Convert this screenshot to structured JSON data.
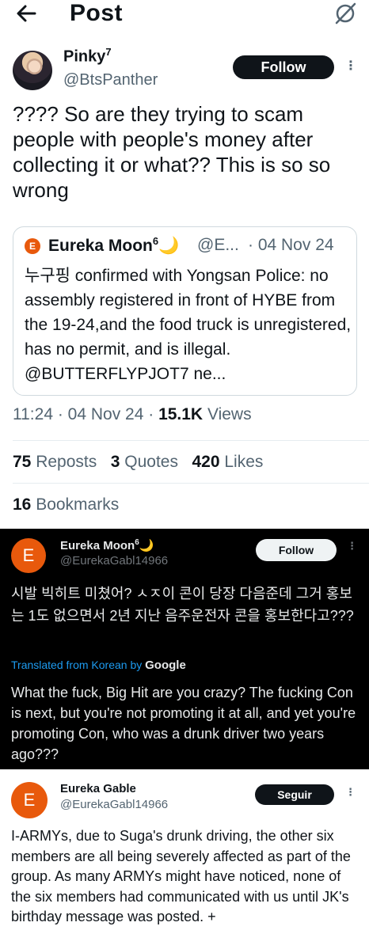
{
  "header": {
    "title": "Post",
    "back_icon": "back-arrow-icon",
    "grok_icon": "grok-icon"
  },
  "post": {
    "author_name": "Pinky",
    "author_superscript": "7",
    "author_handle": "@BtsPanther",
    "follow_label": "Follow",
    "text": "???? So are they trying to scam people with people's money after collecting it or what?? This is so so wrong",
    "quote": {
      "avatar_letter": "E",
      "author_name": "Eureka Moon",
      "author_superscript": "6",
      "moon_emoji": "🌙",
      "author_handle": "@E...",
      "date": "· 04 Nov 24",
      "text": "누구핑 confirmed with Yongsan Police: no assembly registered in front of HYBE from the 19-24,and the food truck is unregistered, has no permit, and is illegal. @BUTTERFLYPJOT7 ne..."
    },
    "timestamp": "11:24 · 04 Nov 24 · ",
    "views_count": "15.1K",
    "views_label": " Views",
    "reposts_count": "75",
    "reposts_label": " Reposts",
    "quotes_count": "3",
    "quotes_label": " Quotes",
    "likes_count": "420",
    "likes_label": " Likes",
    "bookmarks_count": "16",
    "bookmarks_label": " Bookmarks"
  },
  "dark_reply": {
    "avatar_letter": "E",
    "author_name": "Eureka Moon",
    "author_superscript": "6",
    "moon_emoji": "🌙",
    "author_handle": "@EurekaGabl14966",
    "follow_label": "Follow",
    "korean_text": "시발 빅히트 미쳤어? ㅅㅈ이 콘이 당장 다음준데 그거 홍보는 1도 없으면서 2년 지난 음주운전자 콘을 홍보한다고???",
    "translated_label": "Translated from Korean by ",
    "translator": "Google",
    "english_text": "What the fuck, Big Hit are you crazy? The fucking Con is next, but you're not promoting it at all, and yet you're promoting Con, who was a drunk driver two years ago???"
  },
  "light_reply": {
    "avatar_letter": "E",
    "author_name": "Eureka Gable",
    "author_handle": "@EurekaGabl14966",
    "follow_label": "Seguir",
    "text": "I-ARMYs, due to Suga's drunk driving, the other six members are all being severely affected as part of the group. As many ARMYs might have noticed, none of the six members had communicated with us until JK's birthday message was posted. +"
  },
  "colors": {
    "accent_orange": "#e8590c",
    "link_blue": "#1d9bf0",
    "text_dark": "#0f1419",
    "text_muted": "#536471"
  }
}
